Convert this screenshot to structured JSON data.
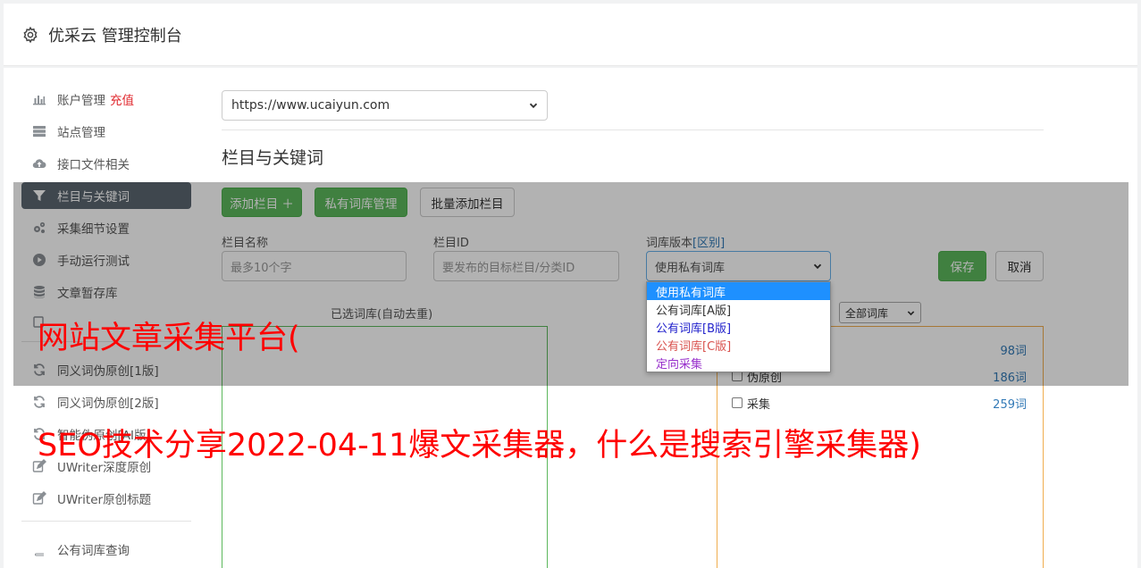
{
  "header": {
    "title": "优采云 管理控制台",
    "icon": "gear-icon"
  },
  "sidebar": {
    "items": [
      {
        "label": "账户管理",
        "extra": "充值",
        "icon": "bar-chart-icon"
      },
      {
        "label": "站点管理",
        "icon": "server-icon"
      },
      {
        "label": "接口文件相关",
        "icon": "cloud-upload-icon"
      },
      {
        "label": "栏目与关键词",
        "icon": "filter-icon",
        "active": true
      },
      {
        "label": "采集细节设置",
        "icon": "cogs-icon"
      },
      {
        "label": "手动运行测试",
        "icon": "play-circle-icon"
      },
      {
        "label": "文章暂存库",
        "icon": "database-icon"
      }
    ],
    "items2": [
      {
        "label": "同义词伪原创[1版]",
        "icon": "refresh-icon"
      },
      {
        "label": "同义词伪原创[2版]",
        "icon": "refresh-icon"
      },
      {
        "label": "智能伪原创[AI版]",
        "icon": "refresh-icon"
      },
      {
        "label": "UWriter深度原创",
        "icon": "edit-icon"
      },
      {
        "label": "UWriter原创标题",
        "icon": "edit-icon"
      }
    ],
    "items3": [
      {
        "label": "公有词库查询",
        "icon": "book-icon"
      }
    ]
  },
  "content": {
    "site_select": "https://www.ucaiyun.com",
    "section_title": "栏目与关键词",
    "buttons": {
      "add_column": "添加栏目 ＋",
      "private_lib": "私有词库管理",
      "batch_add": "批量添加栏目",
      "save": "保存",
      "cancel": "取消"
    },
    "form": {
      "column_name_label": "栏目名称",
      "column_name_placeholder": "最多10个字",
      "column_id_label": "栏目ID",
      "column_id_placeholder": "要发布的目标栏目/分类ID",
      "lib_version_label": "词库版本",
      "lib_version_link": "[区别]",
      "lib_version_value": "使用私有词库"
    },
    "selected_label": "已选词库(自动去重)",
    "filter_value": "全部词库",
    "libraries": [
      {
        "name": "",
        "count": "98词"
      },
      {
        "name": "伪原创",
        "count": "186词"
      },
      {
        "name": "采集",
        "count": "259词"
      }
    ],
    "dropdown": [
      {
        "label": "使用私有词库",
        "color": "#ffffff",
        "selected": true
      },
      {
        "label": "公有词库[A版]",
        "color": "#333333"
      },
      {
        "label": "公有词库[B版]",
        "color": "#2222cc"
      },
      {
        "label": "公有词库[C版]",
        "color": "#d9534f"
      },
      {
        "label": "定向采集",
        "color": "#9932cc"
      }
    ]
  },
  "overlay": {
    "line1": "网站文章采集平台(",
    "line2": "SEO技术分享2022-04-11爆文采集器，什么是搜索引擎采集器)"
  }
}
